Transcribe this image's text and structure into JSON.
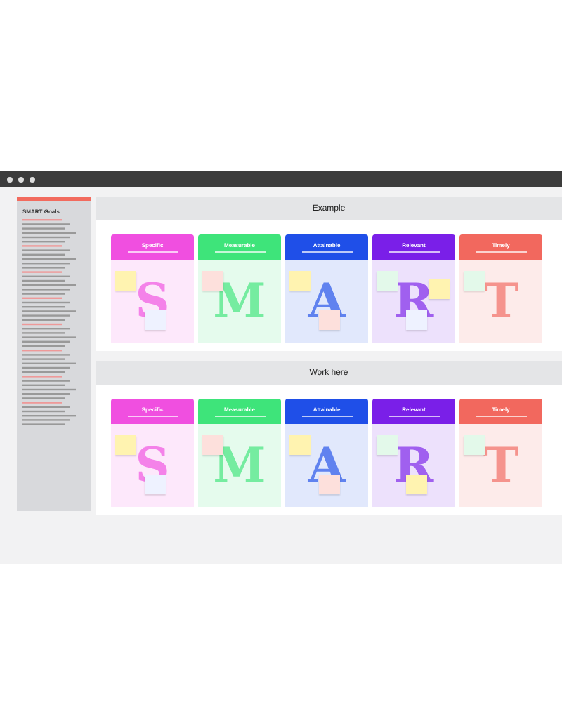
{
  "sidebar": {
    "title": "SMART Goals"
  },
  "sections": [
    {
      "title": "Example",
      "columns": [
        {
          "title": "Specific",
          "letter": "S",
          "color": "#f04fe0",
          "notes": [
            {
              "color": "#fff3b0"
            },
            {
              "color": "#eef2ff"
            }
          ]
        },
        {
          "title": "Measurable",
          "letter": "M",
          "color": "#3ee47a",
          "notes": [
            {
              "color": "#fde0dc"
            }
          ]
        },
        {
          "title": "Attainable",
          "letter": "A",
          "color": "#1f4fe8",
          "notes": [
            {
              "color": "#fff3b0"
            },
            {
              "color": "#fde0dc"
            }
          ]
        },
        {
          "title": "Relevant",
          "letter": "R",
          "color": "#7a1fe8",
          "notes": [
            {
              "color": "#e3f9ea"
            },
            {
              "color": "#eef2ff"
            },
            {
              "color": "#fff3b0"
            }
          ]
        },
        {
          "title": "Timely",
          "letter": "T",
          "color": "#f2685e",
          "notes": [
            {
              "color": "#e3f9ea"
            }
          ]
        }
      ]
    },
    {
      "title": "Work here",
      "columns": [
        {
          "title": "Specific",
          "letter": "S",
          "color": "#f04fe0",
          "notes": [
            {
              "color": "#fff3b0"
            },
            {
              "color": "#eef2ff"
            }
          ]
        },
        {
          "title": "Measurable",
          "letter": "M",
          "color": "#3ee47a",
          "notes": [
            {
              "color": "#fde0dc"
            }
          ]
        },
        {
          "title": "Attainable",
          "letter": "A",
          "color": "#1f4fe8",
          "notes": [
            {
              "color": "#fff3b0"
            },
            {
              "color": "#fde0dc"
            }
          ]
        },
        {
          "title": "Relevant",
          "letter": "R",
          "color": "#7a1fe8",
          "notes": [
            {
              "color": "#e3f9ea"
            },
            {
              "color": "#fff3b0"
            }
          ]
        },
        {
          "title": "Timely",
          "letter": "T",
          "color": "#f2685e",
          "notes": [
            {
              "color": "#e3f9ea"
            }
          ]
        }
      ]
    }
  ]
}
